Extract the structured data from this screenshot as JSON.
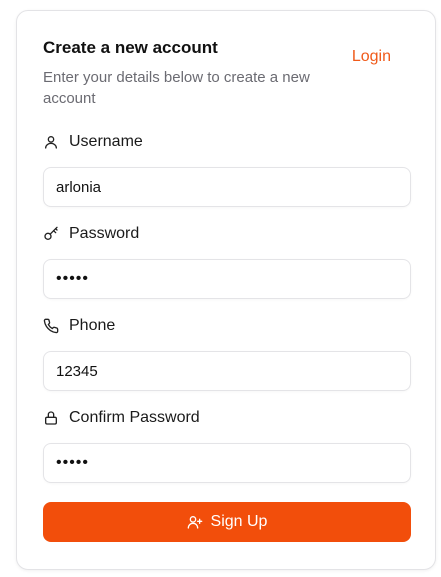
{
  "header": {
    "title": "Create a new account",
    "subtitle": "Enter your details below to create a new account",
    "login_link": "Login"
  },
  "fields": [
    {
      "label": "Username",
      "icon": "user-icon",
      "value": "arlonia",
      "type": "text"
    },
    {
      "label": "Password",
      "icon": "key-icon",
      "value": "12345",
      "type": "password"
    },
    {
      "label": "Phone",
      "icon": "phone-icon",
      "value": "12345",
      "type": "text"
    },
    {
      "label": "Confirm Password",
      "icon": "lock-icon",
      "value": "12345",
      "type": "password"
    }
  ],
  "submit": {
    "label": "Sign Up",
    "icon": "user-plus-icon"
  },
  "colors": {
    "accent": "#f24e0b",
    "link": "#f05a1a",
    "muted_text": "#6b6b72",
    "border": "#e4e4e7"
  }
}
